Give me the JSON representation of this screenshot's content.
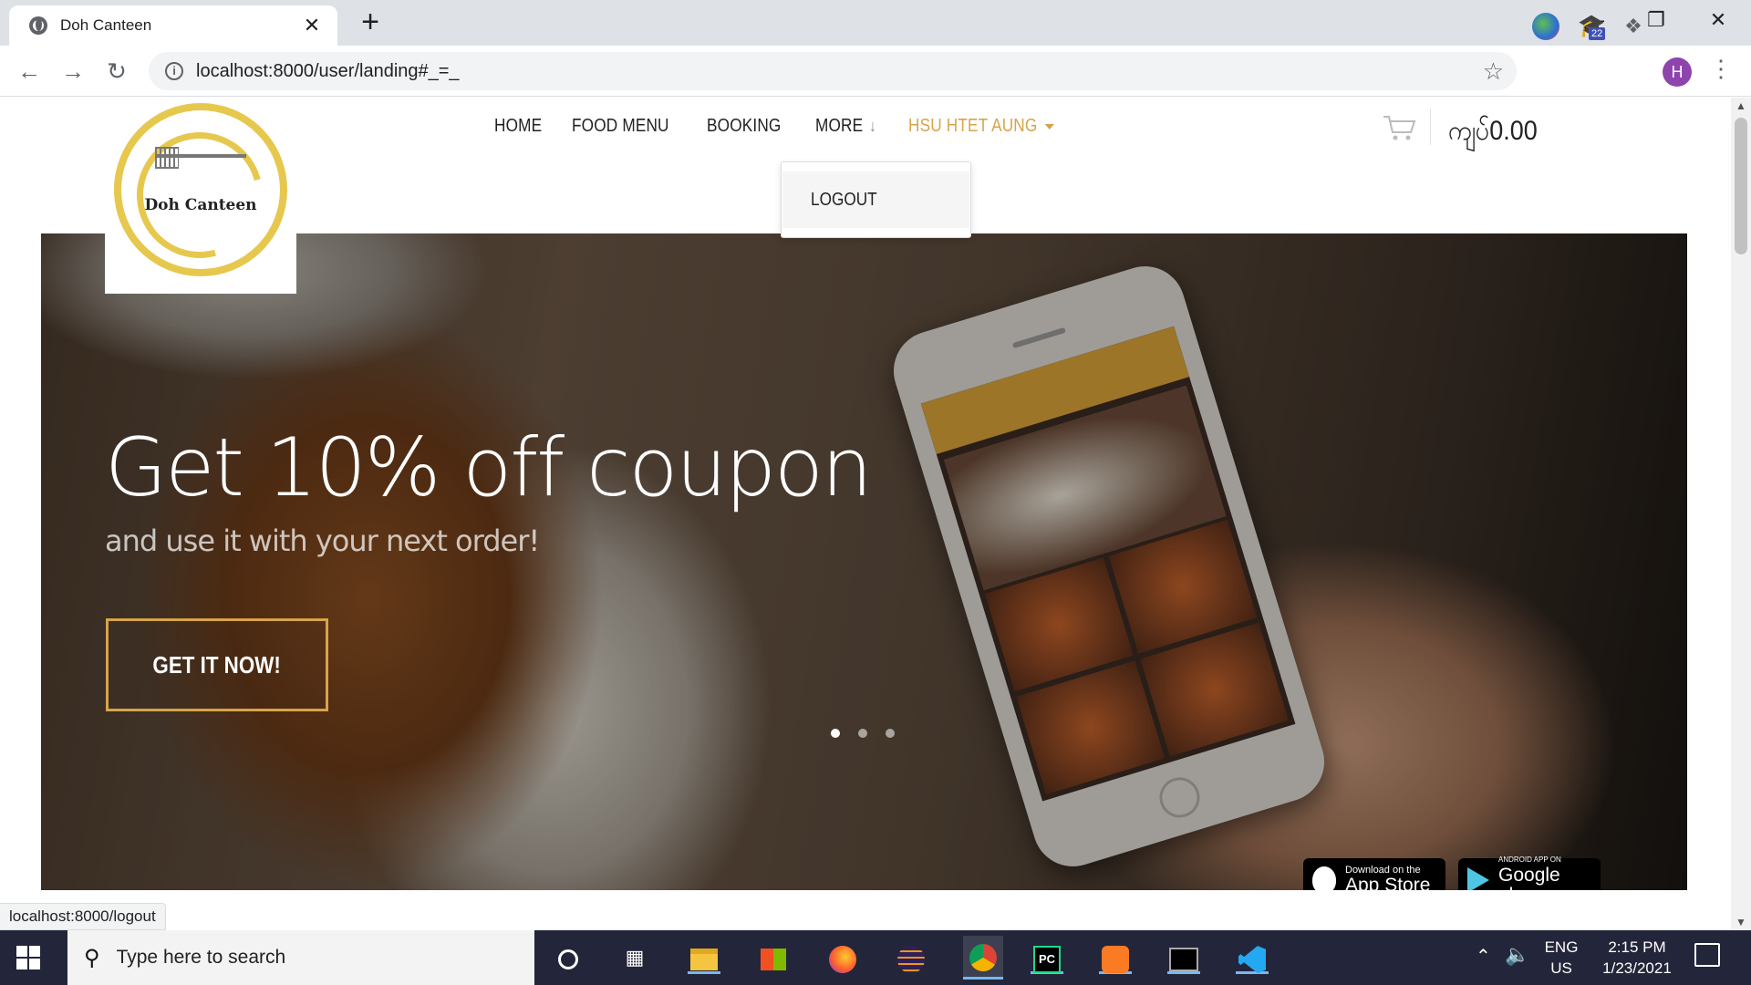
{
  "browser": {
    "tab_title": "Doh Canteen",
    "tab_close": "✕",
    "new_tab": "+",
    "window_controls": {
      "minimize": "—",
      "restore": "❐",
      "close": "✕"
    },
    "back": "←",
    "forward": "→",
    "reload": "↻",
    "info": "i",
    "url": "localhost:8000/user/landing#_=_",
    "bookmark": "☆",
    "extension_badge": "22",
    "profile_initial": "H",
    "menu": "⋮",
    "status_url": "localhost:8000/logout"
  },
  "site": {
    "logo_text": "Doh Canteen",
    "nav": {
      "home": "HOME",
      "food_menu": "FOOD MENU",
      "booking": "BOOKING",
      "more": "MORE",
      "user": "HSU HTET AUNG"
    },
    "dropdown": {
      "logout": "LOGOUT"
    },
    "cart_total": "ကျပ်0.00"
  },
  "hero": {
    "title": "Get 10% off coupon",
    "subtitle": "and use it with your next order!",
    "cta": "GET IT NOW!",
    "slides": 3,
    "active_slide": 1,
    "app_store": {
      "small": "Download on the",
      "large": "App Store"
    },
    "google_play": {
      "small": "ANDROID APP ON",
      "large": "Google play"
    }
  },
  "taskbar": {
    "search_placeholder": "Type here to search",
    "lang_top": "ENG",
    "lang_bottom": "US",
    "time": "2:15 PM",
    "date": "1/23/2021",
    "pycharm_label": "PC"
  },
  "colors": {
    "accent_gold": "#d7a44b",
    "logo_yellow": "#e6c84e",
    "taskbar": "#23263a"
  }
}
